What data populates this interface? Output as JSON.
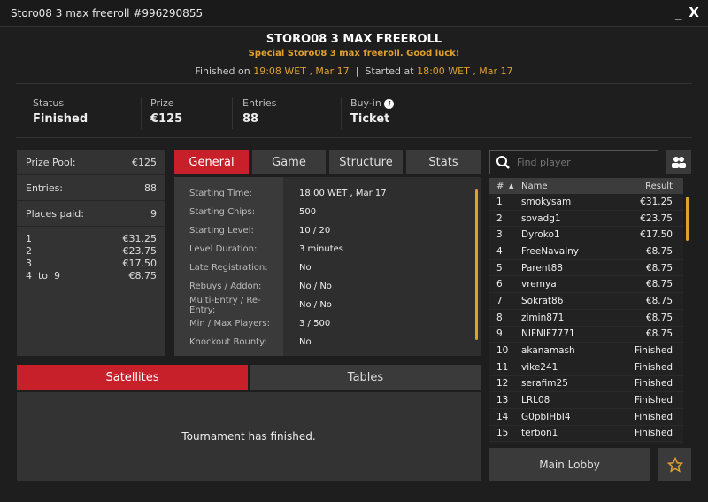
{
  "window": {
    "title": "Storo08 3 max freeroll #996290855",
    "minimize": "_",
    "close": "X"
  },
  "header": {
    "name": "STORO08 3 MAX FREEROLL",
    "subtitle": "Special Storo08 3 max freeroll. Good luck!",
    "finished_label": "Finished on",
    "finished_time": "19:08 WET , Mar 17",
    "separator": "|",
    "started_label": "Started at",
    "started_time": "18:00 WET , Mar 17"
  },
  "summary": [
    {
      "label": "Status",
      "value": "Finished"
    },
    {
      "label": "Prize",
      "value": "€125"
    },
    {
      "label": "Entries",
      "value": "88"
    },
    {
      "label": "Buy-in",
      "value": "Ticket"
    }
  ],
  "prize_panel": {
    "rows": [
      {
        "label": "Prize Pool:",
        "value": "€125"
      },
      {
        "label": "Entries:",
        "value": "88"
      },
      {
        "label": "Places paid:",
        "value": "9"
      }
    ],
    "payouts": [
      {
        "place": "1",
        "amount": "€31.25"
      },
      {
        "place": "2",
        "amount": "€23.75"
      },
      {
        "place": "3",
        "amount": "€17.50"
      },
      {
        "place": "4  to  9",
        "amount": "€8.75"
      }
    ]
  },
  "tabs": [
    "General",
    "Game",
    "Structure",
    "Stats"
  ],
  "general": [
    {
      "label": "Starting Time:",
      "value": "18:00 WET , Mar 17"
    },
    {
      "label": "Starting Chips:",
      "value": "500"
    },
    {
      "label": "Starting Level:",
      "value": "10 / 20"
    },
    {
      "label": "Level Duration:",
      "value": "3 minutes"
    },
    {
      "label": "Late Registration:",
      "value": "No"
    },
    {
      "label": "Rebuys / Addon:",
      "value": "No / No"
    },
    {
      "label": "Multi-Entry / Re-Entry:",
      "value": "No / No"
    },
    {
      "label": "Min / Max Players:",
      "value": "3 / 500"
    },
    {
      "label": "Knockout Bounty:",
      "value": "No"
    }
  ],
  "bottom_tabs": [
    "Satellites",
    "Tables"
  ],
  "bottom_message": "Tournament has finished.",
  "search": {
    "placeholder": "Find player"
  },
  "players": {
    "headers": {
      "num": "#",
      "sort": "▲",
      "name": "Name",
      "result": "Result"
    },
    "rows": [
      [
        "1",
        "smokysam",
        "€31.25"
      ],
      [
        "2",
        "sovadg1",
        "€23.75"
      ],
      [
        "3",
        "Dyroko1",
        "€17.50"
      ],
      [
        "4",
        "FreeNavalny",
        "€8.75"
      ],
      [
        "5",
        "Parent88",
        "€8.75"
      ],
      [
        "6",
        "vremya",
        "€8.75"
      ],
      [
        "7",
        "Sokrat86",
        "€8.75"
      ],
      [
        "8",
        "zimin871",
        "€8.75"
      ],
      [
        "9",
        "NIFNIF7771",
        "€8.75"
      ],
      [
        "10",
        "akanamash",
        "Finished"
      ],
      [
        "11",
        "vike241",
        "Finished"
      ],
      [
        "12",
        "serafim25",
        "Finished"
      ],
      [
        "13",
        "LRL08",
        "Finished"
      ],
      [
        "14",
        "G0pbIHbI4",
        "Finished"
      ],
      [
        "15",
        "terbon1",
        "Finished"
      ]
    ]
  },
  "main_lobby": "Main Lobby",
  "colors": {
    "accent": "#c8202a",
    "highlight": "#e0a030"
  }
}
